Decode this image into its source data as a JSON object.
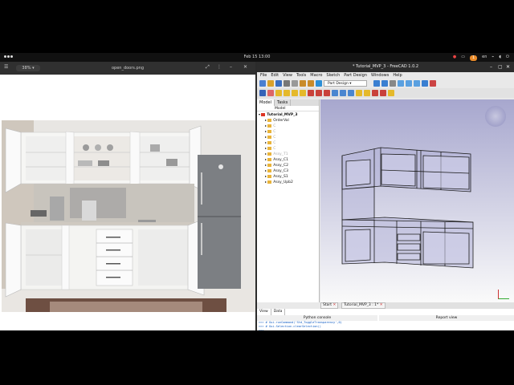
{
  "topbar": {
    "clock": "Feb 15  13:00",
    "pill": "1",
    "lang": "en"
  },
  "viewer": {
    "zoom": "38% ",
    "filename": "open_doors.png"
  },
  "freecad": {
    "title": "* Tutorial_MVP_3 - FreeCAD 1.0.2",
    "menu": [
      "File",
      "Edit",
      "View",
      "Tools",
      "Macro",
      "Sketch",
      "Part Design",
      "Windows",
      "Help"
    ],
    "workbench": "Part Design",
    "combo_tabs": [
      "Model",
      "Tasks"
    ],
    "tree_header": "Model",
    "tree": [
      {
        "label": "Tutorial_MVP_3",
        "level": 0,
        "bold": true
      },
      {
        "label": "OrderVal",
        "level": 1
      },
      {
        "label": "C",
        "level": 1,
        "dim": true
      },
      {
        "label": "C",
        "level": 1,
        "dim": true
      },
      {
        "label": "C",
        "level": 1,
        "dim": true
      },
      {
        "label": "C",
        "level": 1,
        "dim": true
      },
      {
        "label": "C",
        "level": 1,
        "dim": true
      },
      {
        "label": "Assy_T1",
        "level": 1,
        "dim": true
      },
      {
        "label": "Assy_C1",
        "level": 1
      },
      {
        "label": "Assy_C2",
        "level": 1
      },
      {
        "label": "Assy_C3",
        "level": 1
      },
      {
        "label": "Assy_S1",
        "level": 1
      },
      {
        "label": "Assy_Upb2",
        "level": 1
      }
    ],
    "doc_tabs": [
      "Start",
      "Tutorial_MVP_3 : 1*"
    ],
    "bottom_tabs": [
      "View",
      "Data"
    ],
    "python_console_label": "Python console",
    "report_view_label": "Report view",
    "python_lines": [
      ">>> # Gui.runCommand('Std_ToggleTransparency',0)",
      ">>> # Gui.Selection.clearSelection()",
      ">>> "
    ]
  }
}
